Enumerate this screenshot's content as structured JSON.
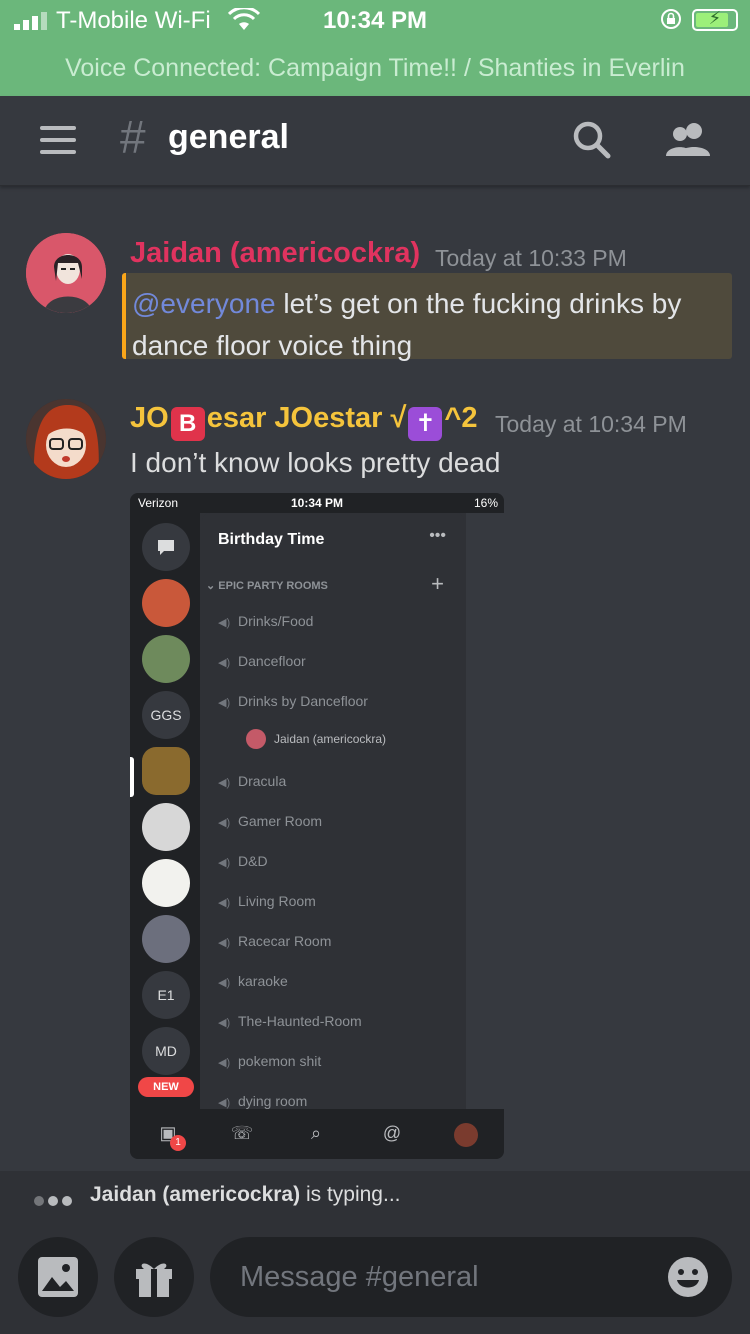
{
  "status_bar": {
    "carrier": "T-Mobile Wi-Fi",
    "time": "10:34 PM",
    "battery_level": 0.85
  },
  "voice_banner": {
    "text": "Voice Connected: Campaign Time!! / Shanties in Everlin"
  },
  "header": {
    "hash": "#",
    "channel": "general",
    "icons": [
      "hamburger-icon",
      "search-icon",
      "members-icon"
    ]
  },
  "messages": [
    {
      "author": "Jaidan (americockra)",
      "author_color": "#e0335f",
      "time": "Today at 10:33 PM",
      "mention": "@everyone",
      "line1": " let’s get on the fucking drinks by",
      "line2": "dance floor voice thing"
    },
    {
      "author_prefix": "JO",
      "author_badge": "B",
      "author_mid": "esar JOestar √",
      "author_badge2": "✝",
      "author_suffix": "^2",
      "author_color": "#f5c43c",
      "time": "Today at 10:34 PM",
      "text": "I don’t know looks pretty dead"
    }
  ],
  "embedded_screenshot": {
    "carrier": "Verizon",
    "time": "10:34 PM",
    "battery": "16%",
    "server_name": "Birthday Time",
    "more": "•••",
    "category": "EPIC PARTY ROOMS",
    "add": "+",
    "rail_labels": [
      "GGS",
      "E1",
      "MD"
    ],
    "rail_new": "NEW",
    "channels": [
      "Drinks/Food",
      "Dancefloor",
      "Drinks by Dancefloor",
      "Dracula",
      "Gamer Room",
      "D&D",
      "Living Room",
      "Racecar Room",
      "karaoke",
      "The-Haunted-Room",
      "pokemon shit",
      "dying room"
    ],
    "connected_user": "Jaidan (americockra)",
    "home_badge": "1"
  },
  "typing": {
    "text_name": "Jaidan (americockra)",
    "text_rest": " is typing..."
  },
  "composer": {
    "placeholder": "Message #general"
  },
  "colors": {
    "background": "#36393f",
    "banner": "#6bb77b",
    "mention_bg": "#4f4a3c",
    "mention_border": "#faa61a",
    "mention_text": "#7289da"
  }
}
